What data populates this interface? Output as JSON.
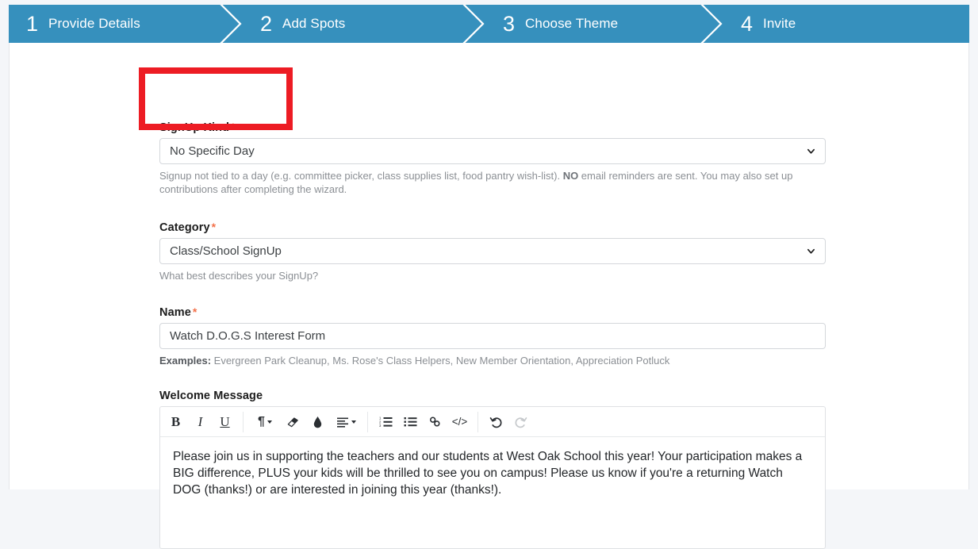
{
  "wizard": {
    "steps": [
      {
        "num": "1",
        "label": "Provide Details"
      },
      {
        "num": "2",
        "label": "Add Spots"
      },
      {
        "num": "3",
        "label": "Choose Theme"
      },
      {
        "num": "4",
        "label": "Invite"
      }
    ],
    "bar_color": "#3690bd",
    "text_color": "#ffffff"
  },
  "form": {
    "signup_kind": {
      "label": "SignUp Kind",
      "required_marker": "*",
      "value": "No Specific Day",
      "help_before": "Signup not tied to a day (e.g. committee picker, class supplies list, food pantry wish-list). ",
      "help_bold": "NO",
      "help_after": " email reminders are sent. You may also set up contributions after completing the wizard."
    },
    "category": {
      "label": "Category",
      "required_marker": "*",
      "value": "Class/School SignUp",
      "help": "What best describes your SignUp?"
    },
    "name": {
      "label": "Name",
      "required_marker": "*",
      "value": "Watch D.O.G.S Interest Form",
      "help_label": "Examples:",
      "help_text": " Evergreen Park Cleanup, Ms. Rose's Class Helpers, New Member Orientation, Appreciation Potluck"
    },
    "welcome_message": {
      "label": "Welcome Message",
      "body": "Please join us in supporting the teachers and our students at West Oak School this year! Your participation makes a BIG difference, PLUS your kids will be thrilled to see you on campus! Please us know if you're a returning Watch DOG (thanks!) or are interested in joining this year (thanks!)."
    }
  },
  "editor_toolbar": {
    "bold": "B",
    "italic": "I",
    "underline": "U",
    "paragraph": "¶",
    "eraser": "eraser-icon",
    "text_color": "droplet-icon",
    "align": "align-left-icon",
    "ordered_list": "ordered-list-icon",
    "unordered_list": "unordered-list-icon",
    "link": "link-icon",
    "code": "</>",
    "undo": "undo-icon",
    "redo": "redo-icon"
  },
  "annotation": {
    "highlight_color": "#ed1c24",
    "target": "signup-kind-field"
  }
}
